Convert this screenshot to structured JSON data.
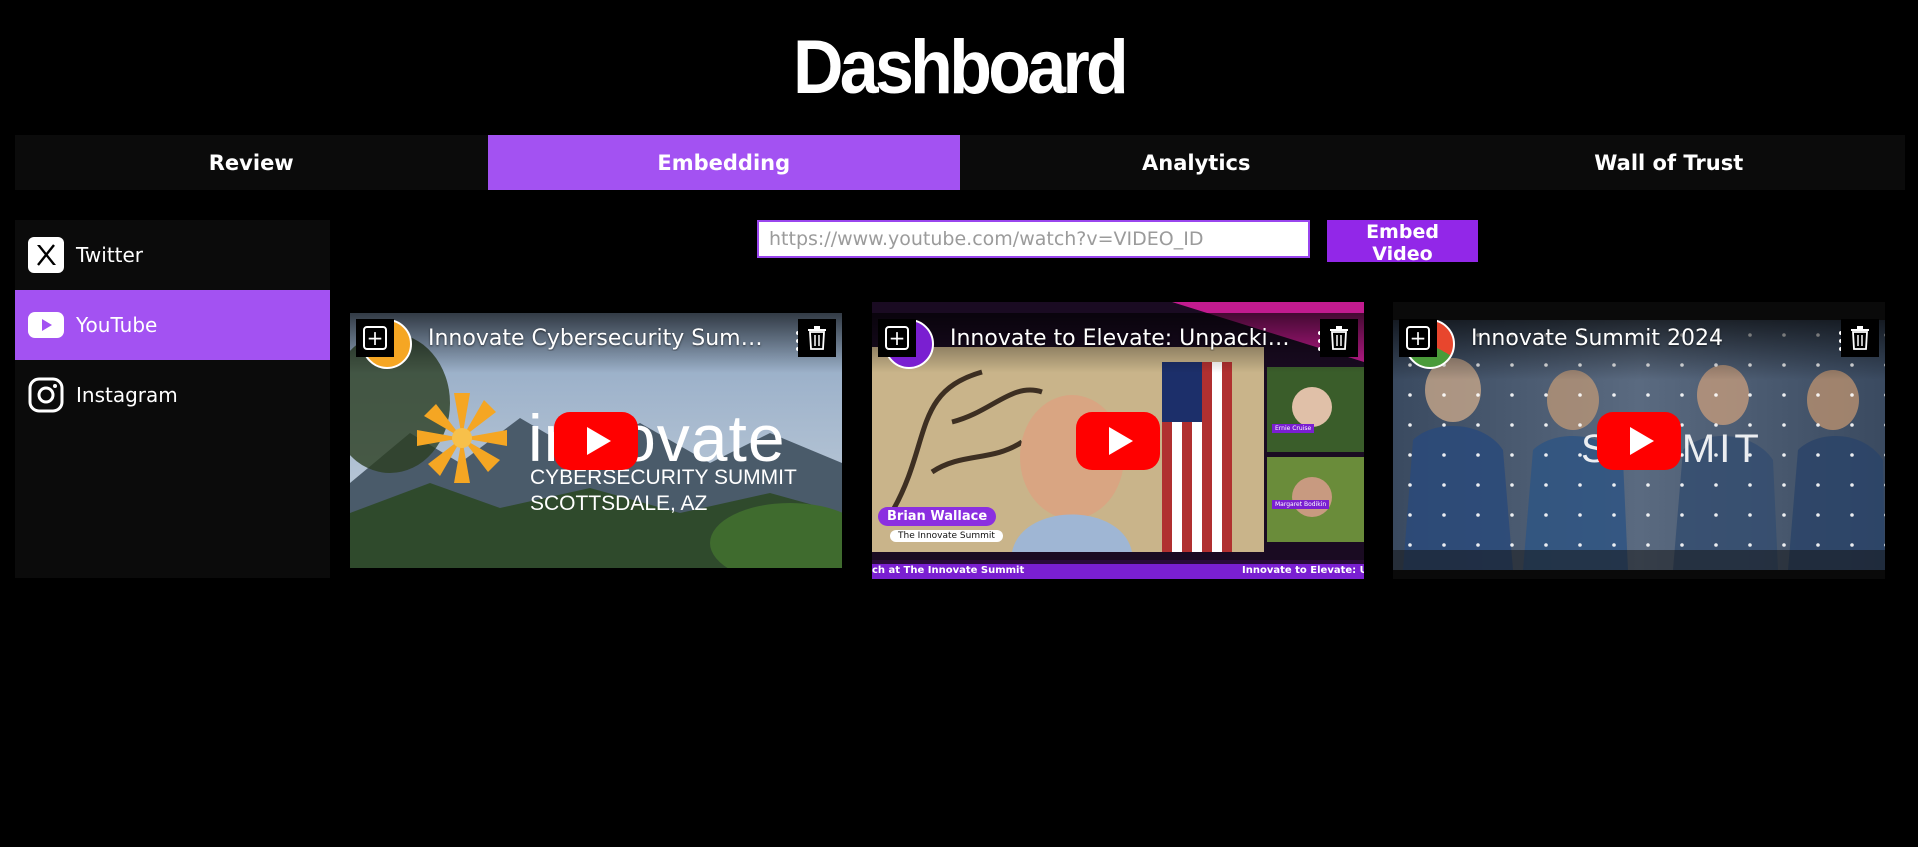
{
  "header": {
    "title": "Dashboard"
  },
  "tabs": [
    {
      "label": "Review",
      "active": false
    },
    {
      "label": "Embedding",
      "active": true
    },
    {
      "label": "Analytics",
      "active": false
    },
    {
      "label": "Wall of Trust",
      "active": false
    }
  ],
  "sidebar": {
    "items": [
      {
        "label": "Twitter",
        "icon": "x-twitter-icon",
        "active": false
      },
      {
        "label": "YouTube",
        "icon": "youtube-icon",
        "active": true
      },
      {
        "label": "Instagram",
        "icon": "instagram-icon",
        "active": false
      }
    ]
  },
  "embed": {
    "placeholder": "https://www.youtube.com/watch?v=VIDEO_ID",
    "button_label": "Embed Video"
  },
  "videos": [
    {
      "title": "Innovate Cybersecurity Summit",
      "thumb_text": {
        "brand": "innovate",
        "line1": "CYBERSECURITY SUMMIT",
        "line2": "SCOTTSDALE, AZ"
      }
    },
    {
      "title": "Innovate to Elevate: Unpacking t...",
      "thumb_text": {
        "speaker": "Brian Wallace",
        "speaker_sub": "The Innovate Summit",
        "ticker_left": "ch at The Innovate Summit",
        "ticker_right": "Innovate to Elevate: Unpac",
        "guest1": "Ernie Cruise",
        "guest2": "Margaret Bodikin"
      }
    },
    {
      "title": "Innovate Summit 2024",
      "thumb_text": {
        "overlay": "SUMMIT"
      }
    }
  ],
  "colors": {
    "accent": "#a352f2",
    "embed_button": "#9227e8",
    "youtube_red": "#ff0000"
  }
}
